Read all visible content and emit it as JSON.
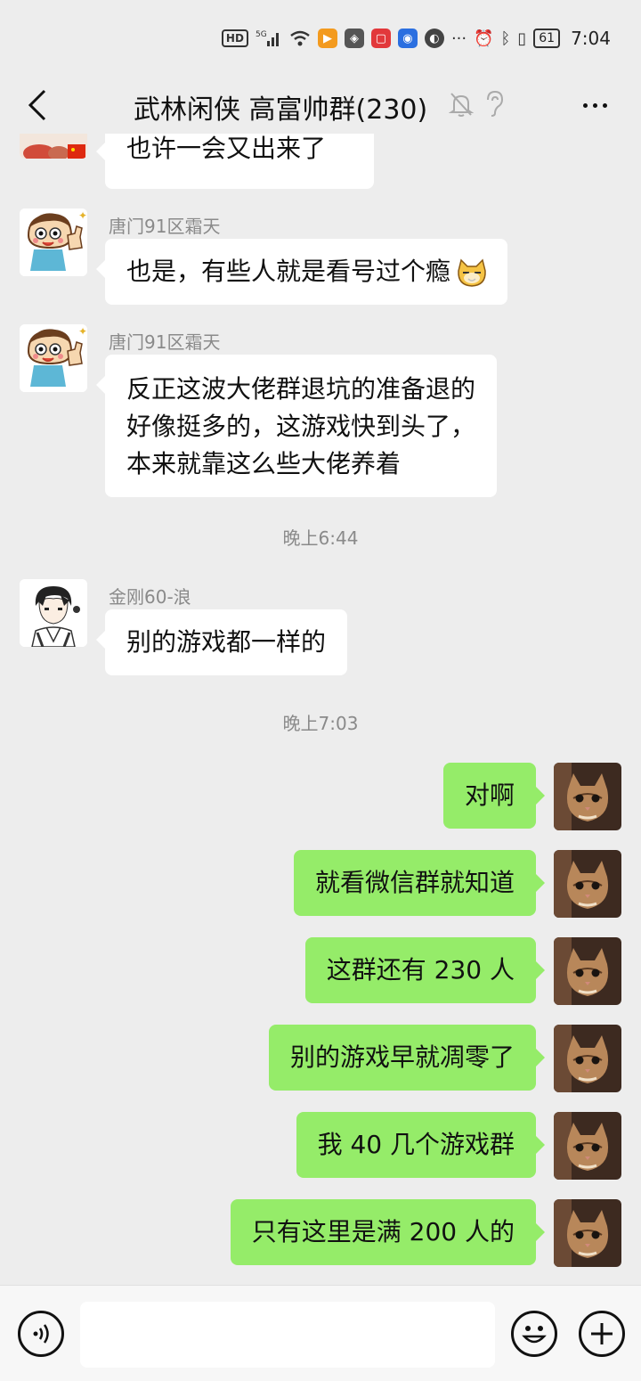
{
  "status_bar": {
    "hd": "HD",
    "signal": "5G",
    "battery": "61",
    "time": "7:04",
    "more": "···"
  },
  "header": {
    "title": "武林闲侠 高富帅群(230)",
    "icons": [
      "back-icon",
      "mute-bell-icon",
      "ear-icon",
      "more-icon"
    ]
  },
  "messages": [
    {
      "side": "left",
      "sender": "",
      "text": "也许一会又出来了",
      "avatar": "partial-avatar"
    },
    {
      "side": "left",
      "sender": "唐门91区霜天",
      "text": "也是，有些人就是看号过个瘾",
      "emoji": "cat-emoji",
      "avatar": "cartoon-thumbs-up"
    },
    {
      "side": "left",
      "sender": "唐门91区霜天",
      "lines": [
        "反正这波大佬群退坑的准备退的",
        "好像挺多的，这游戏快到头了，",
        "本来就靠这么些大佬养着"
      ],
      "avatar": "cartoon-thumbs-up"
    },
    {
      "timestamp": "晚上6:44"
    },
    {
      "side": "left",
      "sender": "金刚60-浪",
      "text": "别的游戏都一样的",
      "avatar": "anime-boy"
    },
    {
      "timestamp": "晚上7:03"
    },
    {
      "side": "right",
      "text": "对啊",
      "avatar": "cat-photo"
    },
    {
      "side": "right",
      "text": "就看微信群就知道",
      "avatar": "cat-photo"
    },
    {
      "side": "right",
      "text": "这群还有 230 人",
      "avatar": "cat-photo"
    },
    {
      "side": "right",
      "text": "别的游戏早就凋零了",
      "avatar": "cat-photo"
    },
    {
      "side": "right",
      "text": "我 40 几个游戏群",
      "avatar": "cat-photo"
    },
    {
      "side": "right",
      "text": "只有这里是满 200 人的",
      "avatar": "cat-photo"
    }
  ],
  "input_bar": {
    "value": "",
    "icons": [
      "voice-icon",
      "emoji-icon",
      "plus-icon"
    ]
  },
  "colors": {
    "background": "#ededed",
    "my_bubble": "#95ec69",
    "their_bubble": "#ffffff",
    "meta_text": "#8a8a8a"
  }
}
